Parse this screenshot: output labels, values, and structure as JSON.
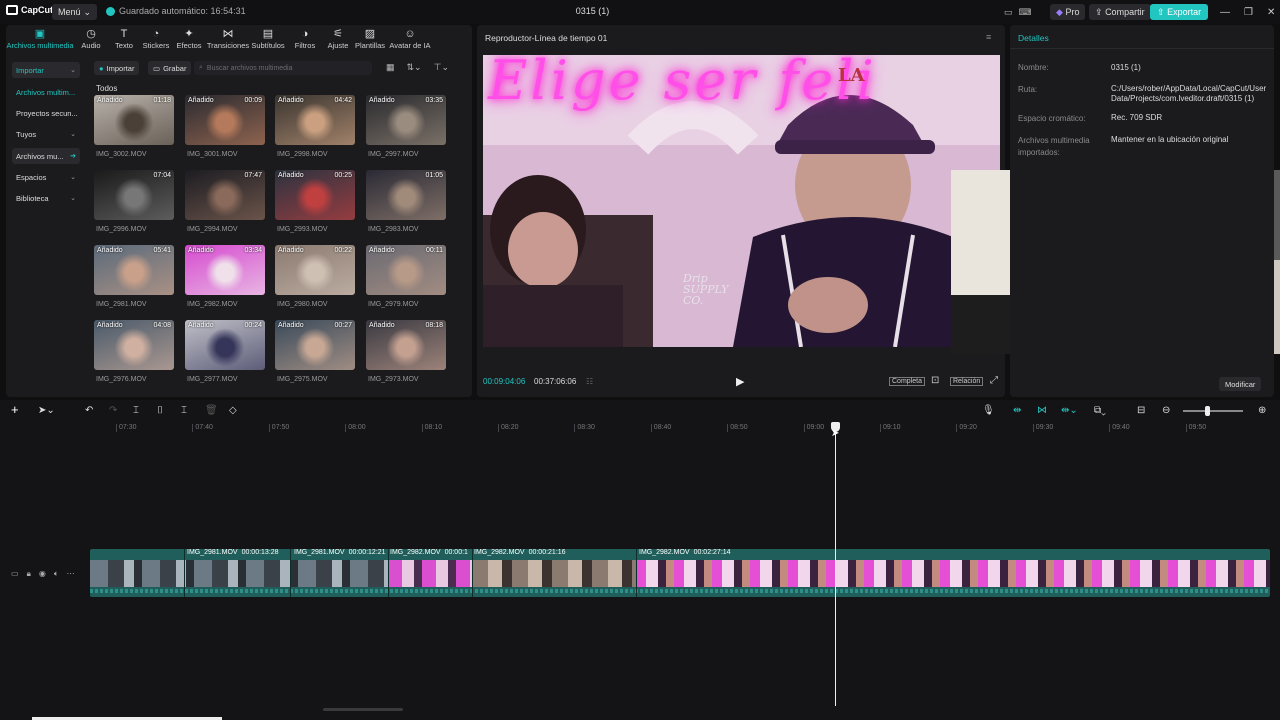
{
  "titlebar": {
    "logo": "CapCut",
    "menu": "Menú",
    "autosave": "Guardado automático: 16:54:31",
    "project": "0315 (1)",
    "pro": "Pro",
    "share": "Compartir",
    "export": "Exportar"
  },
  "toolbar": {
    "tools": [
      {
        "label": "Archivos multimedia",
        "icon": "media-icon"
      },
      {
        "label": "Audio",
        "icon": "audio-icon"
      },
      {
        "label": "Texto",
        "icon": "text-icon"
      },
      {
        "label": "Stickers",
        "icon": "sticker-icon"
      },
      {
        "label": "Efectos",
        "icon": "effects-icon"
      },
      {
        "label": "Transiciones",
        "icon": "transitions-icon"
      },
      {
        "label": "Subtítulos",
        "icon": "subtitles-icon"
      },
      {
        "label": "Filtros",
        "icon": "filters-icon"
      },
      {
        "label": "Ajuste",
        "icon": "adjust-icon"
      },
      {
        "label": "Plantillas",
        "icon": "templates-icon"
      },
      {
        "label": "Avatar de IA",
        "icon": "ai-avatar-icon"
      }
    ]
  },
  "sidebar": {
    "items": [
      "Importar",
      "Archivos multim...",
      "Proyectos secun...",
      "Tuyos",
      "Archivos mu...",
      "Espacios",
      "Biblioteca"
    ]
  },
  "media": {
    "import": "Importar",
    "record": "Grabar",
    "search_placeholder": "Buscar archivos multimedia",
    "all": "Todos",
    "added": "Añadido",
    "items": [
      {
        "name": "IMG_3002.MOV",
        "dur": "01:18",
        "added": true
      },
      {
        "name": "IMG_3001.MOV",
        "dur": "00:09",
        "added": true
      },
      {
        "name": "IMG_2998.MOV",
        "dur": "04:42",
        "added": true
      },
      {
        "name": "IMG_2997.MOV",
        "dur": "03:35",
        "added": true
      },
      {
        "name": "IMG_2996.MOV",
        "dur": "07:04",
        "added": false
      },
      {
        "name": "IMG_2994.MOV",
        "dur": "07:47",
        "added": false
      },
      {
        "name": "IMG_2993.MOV",
        "dur": "00:25",
        "added": true
      },
      {
        "name": "IMG_2983.MOV",
        "dur": "01:05",
        "added": false
      },
      {
        "name": "IMG_2981.MOV",
        "dur": "05:41",
        "added": true
      },
      {
        "name": "IMG_2982.MOV",
        "dur": "03:34",
        "added": true
      },
      {
        "name": "IMG_2980.MOV",
        "dur": "00:22",
        "added": true
      },
      {
        "name": "IMG_2979.MOV",
        "dur": "00:11",
        "added": true
      },
      {
        "name": "IMG_2976.MOV",
        "dur": "04:08",
        "added": true
      },
      {
        "name": "IMG_2977.MOV",
        "dur": "00:24",
        "added": true
      },
      {
        "name": "IMG_2975.MOV",
        "dur": "00:27",
        "added": true
      },
      {
        "name": "IMG_2973.MOV",
        "dur": "08:18",
        "added": true
      }
    ]
  },
  "player": {
    "title": "Reproductor-Línea de tiempo 01",
    "neon_text": "Elige ser feli",
    "cap_logo": "LA",
    "shirt_text": "Drip SUPPLY CO.",
    "current": "00:09:04:06",
    "total": "00:37:06:06",
    "complete": "Completa",
    "ratio": "Relación"
  },
  "details": {
    "header": "Detalles",
    "rows": [
      {
        "label": "Nombre:",
        "value": "0315 (1)"
      },
      {
        "label": "Ruta:",
        "value": "C:/Users/rober/AppData/Local/CapCut/User Data/Projects/com.lveditor.draft/0315 (1)"
      },
      {
        "label": "Espacio cromático:",
        "value": "Rec. 709 SDR"
      },
      {
        "label": "Archivos multimedia importados:",
        "value": "Mantener en la ubicación original"
      }
    ],
    "modify": "Modificar"
  },
  "timeline": {
    "ruler": [
      "07:30",
      "07:40",
      "07:50",
      "08:00",
      "08:10",
      "08:20",
      "08:30",
      "08:40",
      "08:50",
      "09:00",
      "09:10",
      "09:20",
      "09:30",
      "09:40",
      "09:50"
    ],
    "clips": [
      {
        "name": "IMG_2981.MOV",
        "dur": "00:00:13:28"
      },
      {
        "name": "IMG_2981.MOV",
        "dur": "00:00:12:21"
      },
      {
        "name": "IMG_2982.MOV",
        "dur": "00:00:1"
      },
      {
        "name": "IMG_2982.MOV",
        "dur": "00:00:21:16"
      },
      {
        "name": "IMG_2982.MOV",
        "dur": "00:02:27:14"
      }
    ]
  },
  "colors": {
    "accent": "#21c6c0",
    "background": "#0f0f10",
    "panel": "#1b1b1e"
  }
}
